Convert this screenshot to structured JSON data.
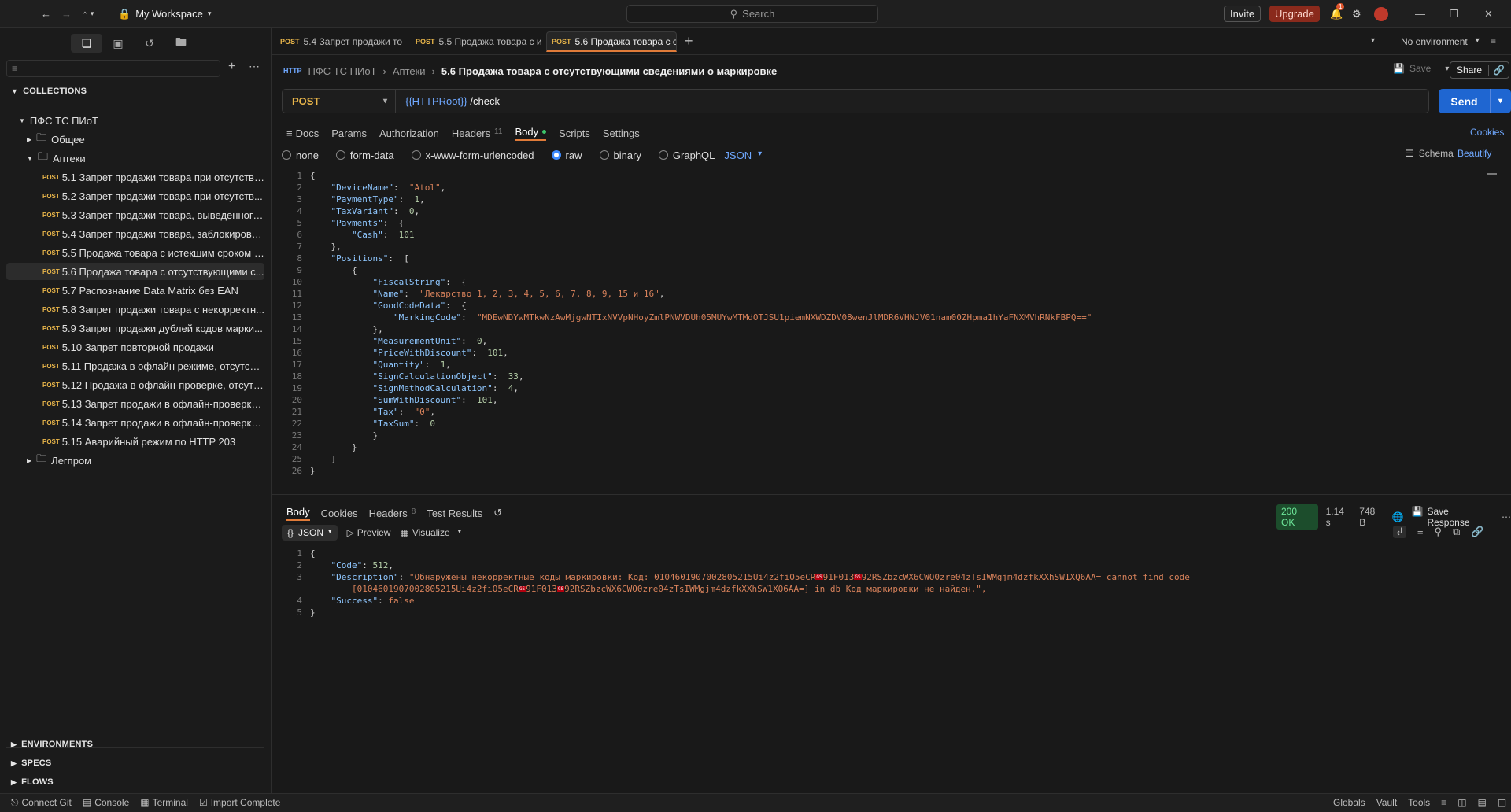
{
  "topbar": {
    "workspace": "My Workspace",
    "search_placeholder": "Search",
    "invite": "Invite",
    "upgrade": "Upgrade",
    "notif_count": "1"
  },
  "sidebar": {
    "collections_label": "COLLECTIONS",
    "root": "ПФС ТС ПИоТ",
    "folders": [
      "Общее",
      "Аптеки",
      "Легпром"
    ],
    "method_tag": "POST",
    "requests": [
      "5.1 Запрет продажи товара при отсутстви...",
      "5.2 Запрет продажи товара при отсутств...",
      "5.3 Запрет продажи товара, выведенного...",
      "5.4 Запрет продажи товара, заблокирова...",
      "5.5 Продажа товара с истекшим сроком г...",
      "5.6 Продажа товара с отсутствующими с...",
      "5.7 Распознание Data Matrix без EAN",
      "5.8 Запрет продажи товара с некорректн...",
      "5.9 Запрет продажи дублей кодов марки...",
      "5.10 Запрет повторной продажи",
      "5.11 Продажа в офлайн режиме, отсутств...",
      "5.12 Продажа в офлайн-проверке, отсутс...",
      "5.13 Запрет продажи в офлайн-проверке,...",
      "5.14 Запрет продажи в офлайн-проверке ...",
      "5.15 Аварийный режим по HTTP 203"
    ],
    "environments": "ENVIRONMENTS",
    "specs": "SPECS",
    "flows": "FLOWS"
  },
  "tabs": [
    {
      "method": "POST",
      "label": "5.4 Запрет продажи то"
    },
    {
      "method": "POST",
      "label": "5.5 Продажа товара с и"
    },
    {
      "method": "POST",
      "label": "5.6 Продажа товара с о"
    }
  ],
  "environment": "No environment",
  "breadcrumb": {
    "root": "ПФС ТС ПИоТ",
    "folder": "Аптеки",
    "current": "5.6 Продажа товара с отсутствующими сведениями о маркировке"
  },
  "toolbar": {
    "save": "Save",
    "share": "Share"
  },
  "request": {
    "method": "POST",
    "url_var": "{{HTTPRoot}}",
    "url_path": "/check",
    "send": "Send",
    "cookies": "Cookies"
  },
  "request_tabs": {
    "docs": "Docs",
    "params": "Params",
    "authorization": "Authorization",
    "headers": "Headers",
    "headers_count": "11",
    "body": "Body",
    "scripts": "Scripts",
    "settings": "Settings"
  },
  "body_types": {
    "none": "none",
    "form_data": "form-data",
    "urlencoded": "x-www-form-urlencoded",
    "raw": "raw",
    "binary": "binary",
    "graphql": "GraphQL",
    "lang": "JSON",
    "schema": "Schema",
    "beautify": "Beautify"
  },
  "request_body": {
    "device_name": "\"Atol\"",
    "payment_type": "1",
    "tax_variant": "0",
    "cash": "101",
    "fiscal_string": "{",
    "name": "\"Лекарство 1, 2, 3, 4, 5, 6, 7, 8, 9, 15 и 16\"",
    "marking_code": "\"MDEwNDYwMTkwNzAwMjgwNTIxNVVpNHoyZmlPNWVDUh05MUYwMTMdOTJSU1piemNXWDZDV08wenJlMDR6VHNJV01nam00ZHpma1hYaFNXMVhRNkFBPQ==\"",
    "measurement_unit": "0",
    "price_with_discount": "101",
    "quantity": "1",
    "sign_calc_object": "33",
    "sign_method_calc": "4",
    "sum_with_discount": "101",
    "tax": "\"0\"",
    "tax_sum": "0"
  },
  "response_tabs": {
    "body": "Body",
    "cookies": "Cookies",
    "headers": "Headers",
    "headers_count": "8",
    "tests": "Test Results"
  },
  "response_meta": {
    "status": "200 OK",
    "time": "1.14 s",
    "size": "748 B",
    "save_response": "Save Response"
  },
  "response_view": {
    "format": "JSON",
    "preview": "Preview",
    "visualize": "Visualize"
  },
  "response_body": {
    "code": "512",
    "desc_a": "\"Обнаружены некорректные коды маркировки: Код: 0104601907002805215Ui4z2fiO5eCR",
    "desc_b": "91F013",
    "desc_c": "92RSZbzcWX6CWO0zre04zTsIWMgjm4dzfkXXhSW1XQ6AA= cannot find code",
    "desc_d": "[0104601907002805215Ui4z2fiO5eCR",
    "desc_e": "91F013",
    "desc_f": "92RSZbzcWX6CWO0zre04zTsIWMgjm4dzfkXXhSW1XQ6AA=] in db Код маркировки не найден.\",",
    "gs": "GS",
    "success": "false"
  },
  "statusbar": {
    "connect_git": "Connect Git",
    "console": "Console",
    "terminal": "Terminal",
    "import": "Import Complete",
    "globals": "Globals",
    "vault": "Vault",
    "tools": "Tools"
  }
}
